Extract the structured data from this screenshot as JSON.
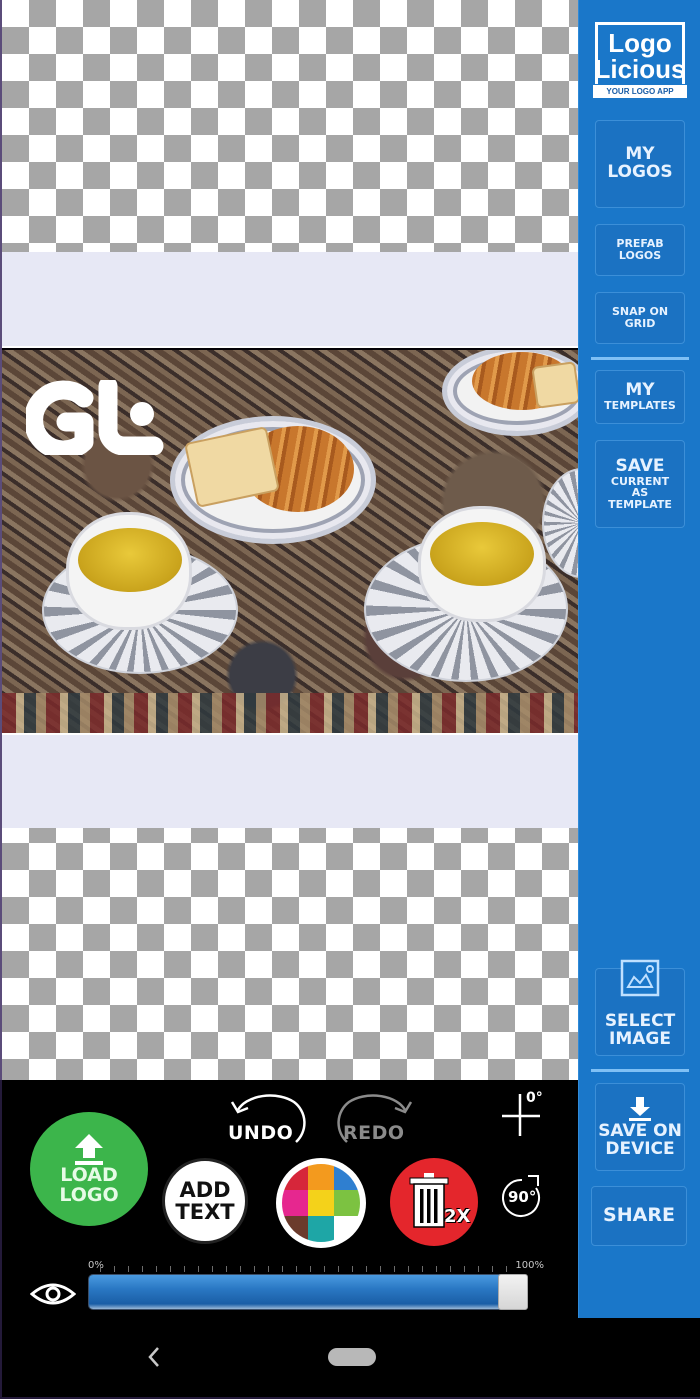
{
  "app": {
    "name": "LogoLicious",
    "logo_line1": "Logo",
    "logo_line2": "Licious",
    "logo_tagline": "YOUR LOGO APP"
  },
  "sidebar": {
    "my_logos": [
      "MY",
      "LOGOS"
    ],
    "prefab_logos": [
      "PREFAB",
      "LOGOS"
    ],
    "snap_on_grid": [
      "SNAP ON",
      "GRID"
    ],
    "my_templates": [
      "MY",
      "TEMPLATES"
    ],
    "save_template": [
      "SAVE",
      "CURRENT",
      "AS",
      "TEMPLATE"
    ],
    "select_image": [
      "SELECT",
      "IMAGE"
    ],
    "save_on_device": [
      "SAVE ON",
      "DEVICE"
    ],
    "share": "SHARE"
  },
  "canvas": {
    "overlay_logo_text": "Gt",
    "image_description": "tea cups and pastries on a patterned rug"
  },
  "toolbar": {
    "load_logo": [
      "LOAD",
      "LOGO"
    ],
    "add_text": [
      "ADD",
      "TEXT"
    ],
    "undo": "UNDO",
    "redo": "REDO",
    "angle": "0°",
    "rotate": "90°",
    "delete_multiplier": "2X",
    "color_palette": [
      "#d6263a",
      "#f39a1e",
      "#2f7fd0",
      "#e6278f",
      "#f4d21a",
      "#7cc241",
      "#6b3b2c",
      "#1ea6a6",
      "#ffffff"
    ]
  },
  "opacity_slider": {
    "min_label": "0%",
    "max_label": "100%",
    "value_percent": 100
  },
  "colors": {
    "sidebar_blue": "#1a77c9",
    "load_green": "#3cb54b",
    "delete_red": "#e4262c"
  }
}
